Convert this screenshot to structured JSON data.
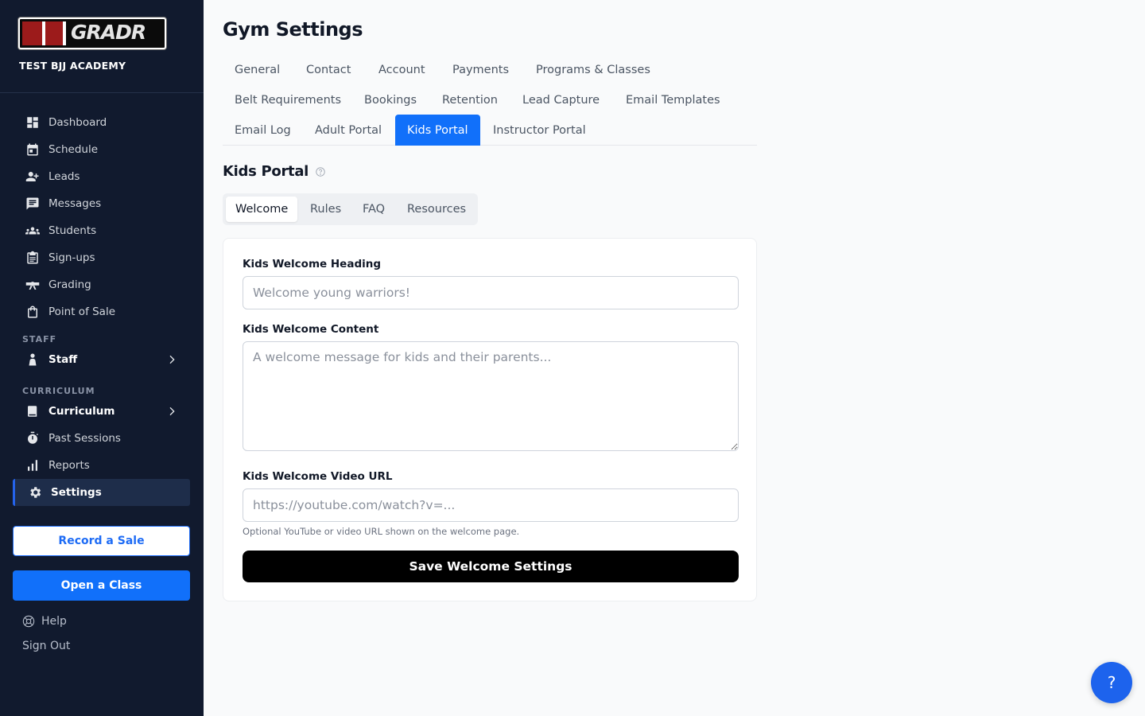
{
  "brand": {
    "logo_text": "GRADR",
    "academy": "TEST BJJ ACADEMY"
  },
  "sidebar": {
    "items": [
      {
        "label": "Dashboard",
        "icon": "dashboard-icon"
      },
      {
        "label": "Schedule",
        "icon": "calendar-icon"
      },
      {
        "label": "Leads",
        "icon": "add-person-icon"
      },
      {
        "label": "Messages",
        "icon": "chat-icon"
      },
      {
        "label": "Students",
        "icon": "group-icon"
      },
      {
        "label": "Sign-ups",
        "icon": "clipboard-icon"
      },
      {
        "label": "Grading",
        "icon": "belt-icon"
      },
      {
        "label": "Point of Sale",
        "icon": "shopping-bag-icon"
      }
    ],
    "staff_section": "STAFF",
    "staff_item": "Staff",
    "curriculum_section": "CURRICULUM",
    "curriculum_item": "Curriculum",
    "past_sessions": "Past Sessions",
    "reports": "Reports",
    "settings": "Settings",
    "record_sale": "Record a Sale",
    "open_class": "Open a Class",
    "help": "Help",
    "sign_out": "Sign Out"
  },
  "main": {
    "title": "Gym Settings",
    "tabs": [
      "General",
      "Contact",
      "Account",
      "Payments",
      "Programs & Classes",
      "Belt Requirements",
      "Bookings",
      "Retention",
      "Lead Capture",
      "Email Templates",
      "Email Log",
      "Adult Portal",
      "Kids Portal",
      "Instructor Portal"
    ],
    "active_tab": "Kids Portal",
    "section_title": "Kids Portal",
    "subtabs": [
      "Welcome",
      "Rules",
      "FAQ",
      "Resources"
    ],
    "form": {
      "heading_label": "Kids Welcome Heading",
      "heading_placeholder": "Welcome young warriors!",
      "content_label": "Kids Welcome Content",
      "content_placeholder": "A welcome message for kids and their parents...",
      "video_label": "Kids Welcome Video URL",
      "video_placeholder": "https://youtube.com/watch?v=...",
      "video_hint": "Optional YouTube or video URL shown on the welcome page.",
      "save_label": "Save Welcome Settings"
    }
  },
  "fab": {
    "label": "?"
  },
  "colors": {
    "sidebar_bg": "#111a2e",
    "accent": "#1170fa",
    "save_button": "#000000"
  }
}
